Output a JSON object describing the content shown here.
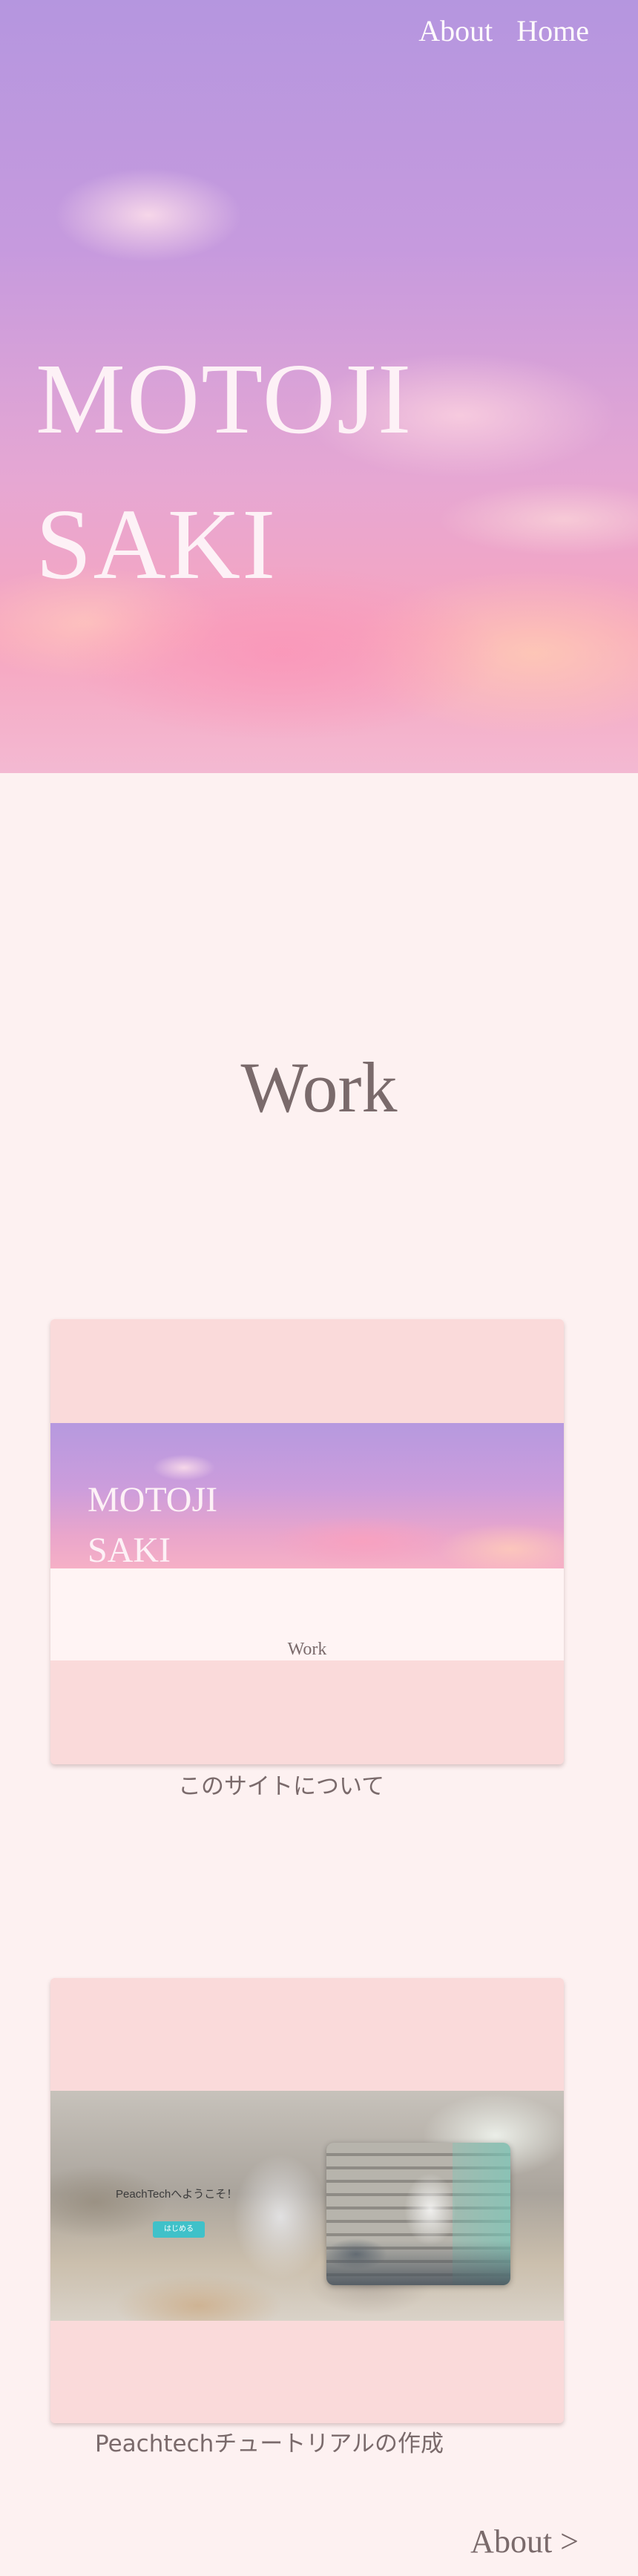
{
  "nav": {
    "items": [
      {
        "label": "About"
      },
      {
        "label": "Home"
      }
    ]
  },
  "hero": {
    "title_line1": "MOTOJI",
    "title_line2": "SAKI"
  },
  "work": {
    "heading": "Work",
    "cards": [
      {
        "preview": {
          "title_line1": "MOTOJI",
          "title_line2": "SAKI",
          "section_label": "Work"
        },
        "caption": "このサイトについて"
      },
      {
        "preview": {
          "welcome_text": "PeachTechへようこそ！",
          "button_label": "はじめる"
        },
        "caption": "Peachtechチュートリアルの作成"
      }
    ]
  },
  "footer": {
    "about_link": "About >"
  },
  "colors": {
    "page_background": "#fdf1f1",
    "card_background": "#fadada",
    "text": "#7a6a6b",
    "hero_text": "#fdf1f6",
    "accent_button": "#3fc1c9"
  }
}
